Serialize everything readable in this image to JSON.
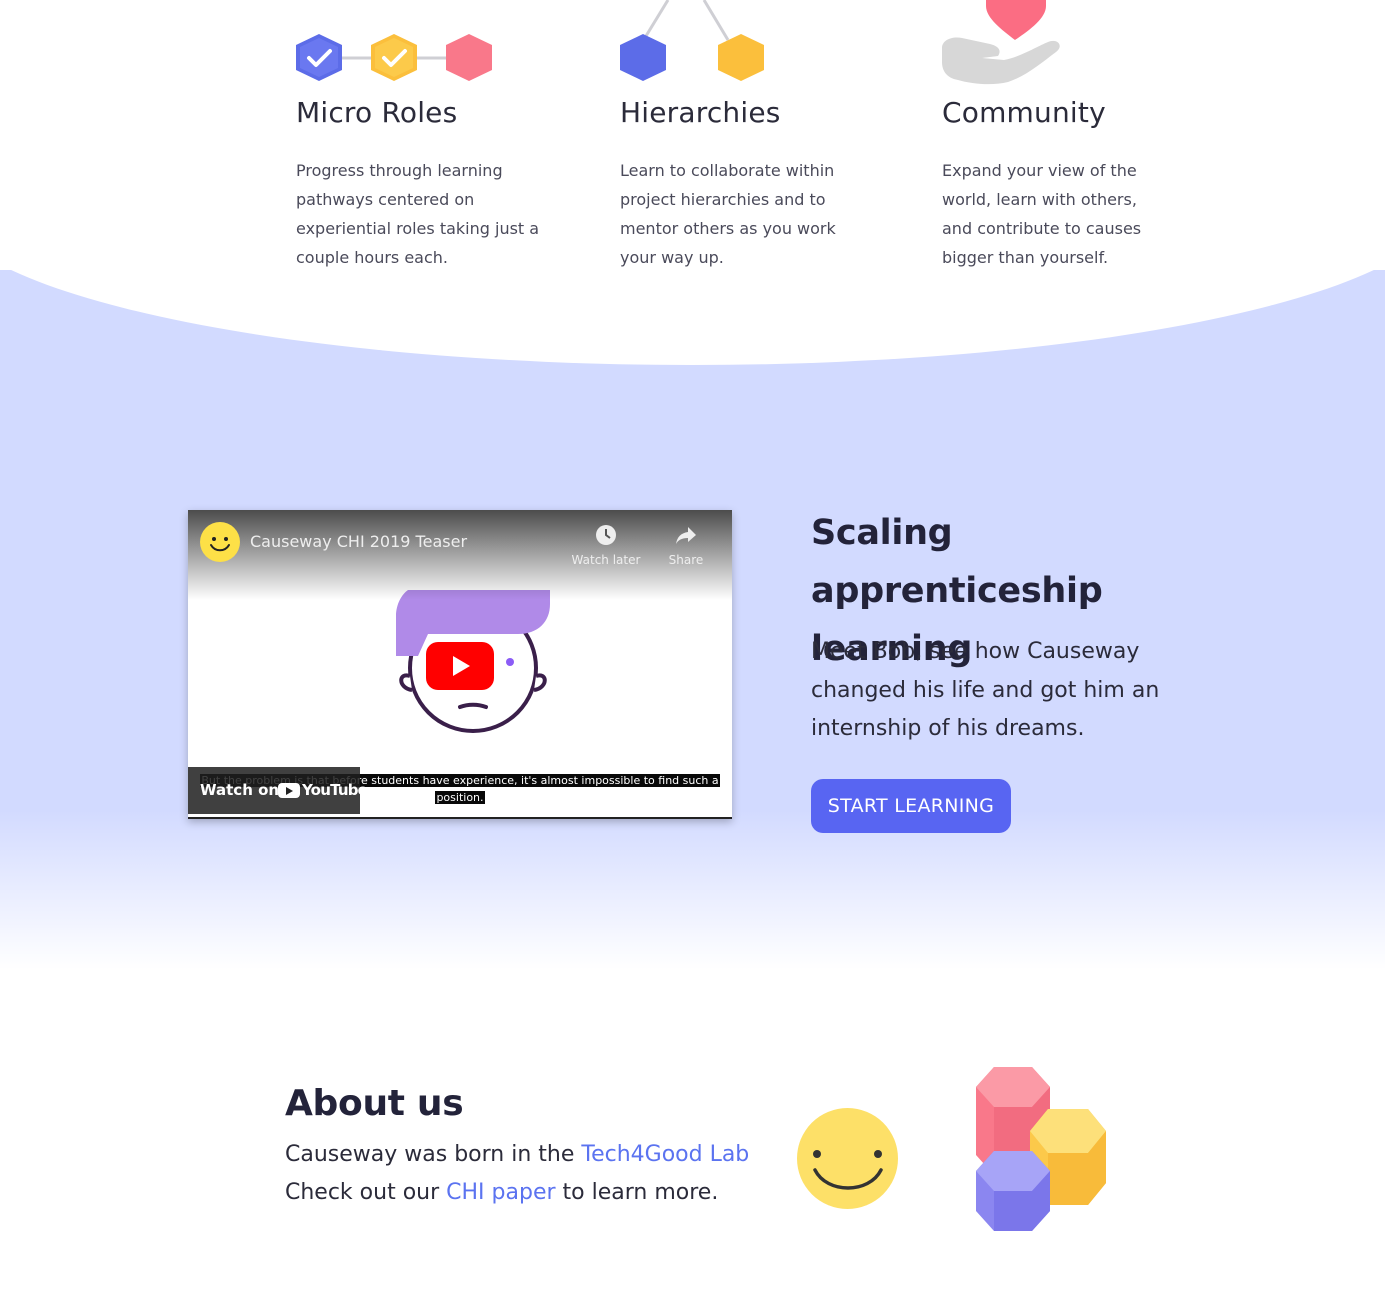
{
  "colors": {
    "accent": "#5865f2",
    "link": "#5b73f0",
    "band": "#d2daff",
    "hex_blue": "#5c6ce8",
    "hex_yellow": "#fbbf3c",
    "hex_pink": "#f9788a",
    "smiley": "#fde068"
  },
  "features": [
    {
      "title": "Micro Roles",
      "text": "Progress through learning pathways centered on experiential roles taking just a couple hours each.",
      "icon": "check-hexagons-icon"
    },
    {
      "title": "Hierarchies",
      "text": "Learn to collaborate within project hierarchies and to mentor others as you work your way up.",
      "icon": "hierarchy-hexagons-icon"
    },
    {
      "title": "Community",
      "text": "Expand your view of the world, learn with others, and contribute to causes bigger than yourself.",
      "icon": "heart-hand-icon"
    }
  ],
  "video": {
    "title": "Causeway CHI 2019 Teaser",
    "watch_later": "Watch later",
    "share": "Share",
    "watch_on": "Watch on",
    "youtube": "YouTube",
    "caption_line1": "But the problem is that before students have experience, it's almost impossible to find such a",
    "caption_line2": "position."
  },
  "scaling": {
    "title": "Scaling apprenticeship learning",
    "text": "Meet Bob, see how Causeway changed his life and got him an internship of his dreams.",
    "button": "START LEARNING"
  },
  "about": {
    "title": "About us",
    "line1_prefix": "Causeway was born in the",
    "line1_link": "Tech4Good Lab",
    "line2_prefix": "Check out our",
    "line2_link": "CHI paper",
    "line2_suffix": "to learn more."
  }
}
